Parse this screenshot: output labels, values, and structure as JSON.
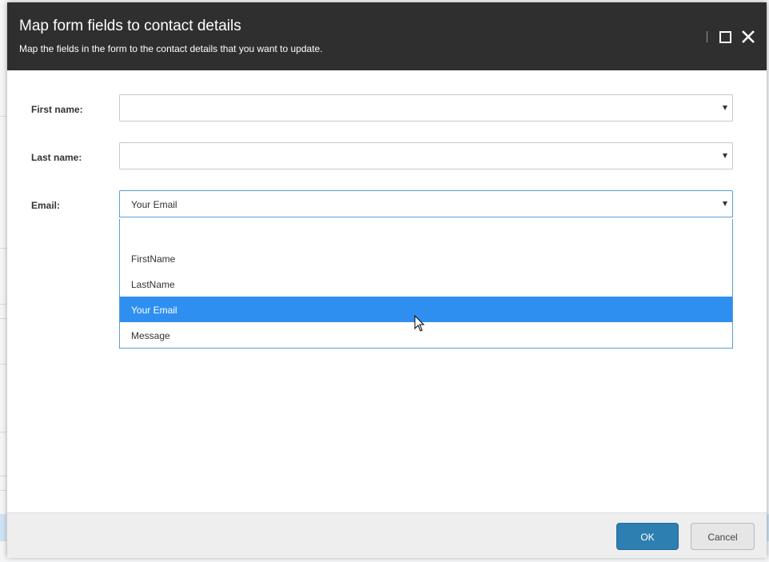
{
  "dialog": {
    "title": "Map form fields to contact details",
    "subtitle": "Map the fields in the form to the contact details that you want to update."
  },
  "fields": [
    {
      "label": "First name:",
      "value": ""
    },
    {
      "label": "Last name:",
      "value": ""
    },
    {
      "label": "Email:",
      "value": "Your Email"
    }
  ],
  "dropdown": {
    "options": [
      "",
      "FirstName",
      "LastName",
      "Your Email",
      "Message"
    ],
    "highlighted": "Your Email"
  },
  "footer": {
    "ok_label": "OK",
    "cancel_label": "Cancel"
  },
  "colors": {
    "header_bg": "#2f2f2f",
    "highlight": "#2f8ff0",
    "ok_button": "#2d7fb1"
  },
  "icons": {
    "maximize": "maximize-icon",
    "close": "close-icon",
    "caret": "caret-down-icon",
    "cursor": "mouse-pointer-icon"
  }
}
